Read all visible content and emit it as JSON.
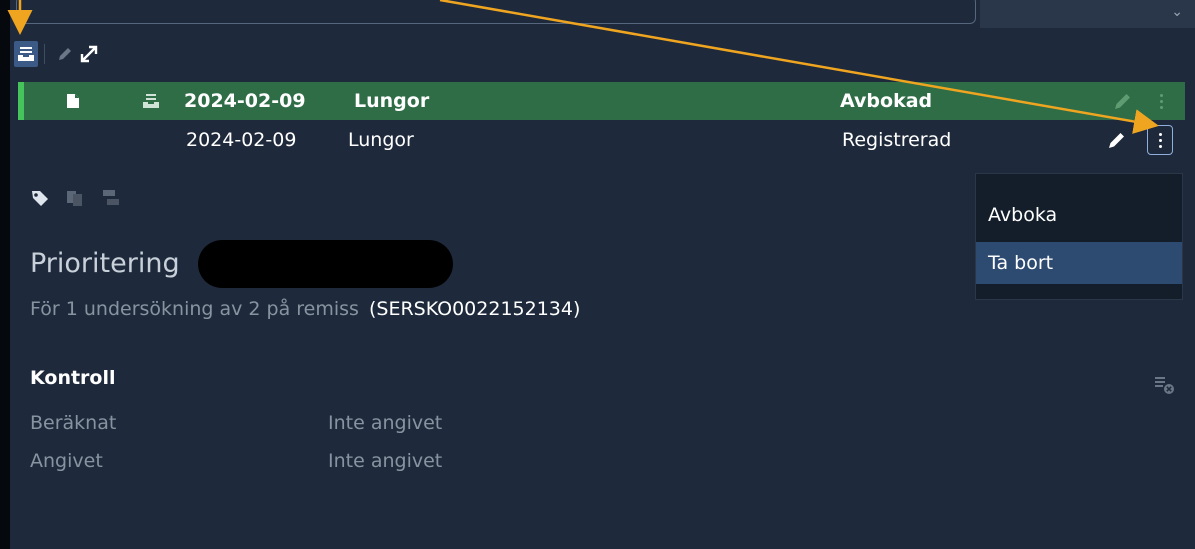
{
  "toolbar": {
    "icons": [
      "inbox-tray-icon",
      "pencil-icon",
      "expand-icon"
    ]
  },
  "rows": [
    {
      "date": "2024-02-09",
      "body_part": "Lungor",
      "status": "Avbokad",
      "selected": true
    },
    {
      "date": "2024-02-09",
      "body_part": "Lungor",
      "status": "Registrerad",
      "selected": false
    }
  ],
  "detail": {
    "title": "Prioritering",
    "subtitle_text": "För 1 undersökning av 2 på remiss",
    "referral_id": "(SERSKO0022152134)"
  },
  "kontroll": {
    "heading": "Kontroll",
    "rows": [
      {
        "label": "Beräknat",
        "value": "Inte angivet"
      },
      {
        "label": "Angivet",
        "value": "Inte angivet"
      }
    ]
  },
  "context_menu": {
    "items": [
      {
        "label": "Avboka",
        "highlighted": false
      },
      {
        "label": "Ta bort",
        "highlighted": true
      }
    ]
  },
  "colors": {
    "background": "#1e2a3b",
    "selected_row": "#2f6d47",
    "selected_accent": "#46c45b",
    "annotation_arrow": "#f0a520",
    "menu_highlight": "#2d4a70"
  }
}
